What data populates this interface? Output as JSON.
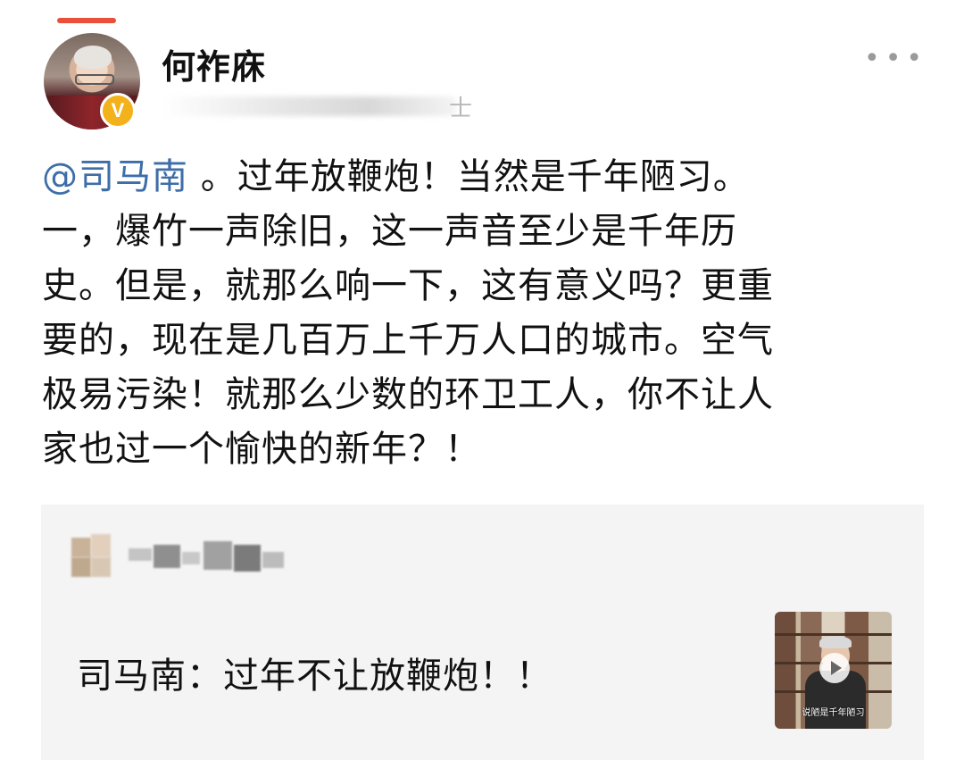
{
  "post": {
    "author": {
      "name": "何祚庥",
      "verified_badge": "V",
      "meta_tail": "士"
    },
    "more_icon": "more-dots-icon",
    "mention": "@司马南",
    "body_lines": [
      " 。过年放鞭炮！当然是千年陋习。",
      "一，爆竹一声除旧，这一声音至少是千年历",
      "史。但是，就那么响一下，这有意义吗？更重",
      "要的，现在是几百万上千万人口的城市。空气",
      "极易污染！就那么少数的环卫工人，你不让人",
      "家也过一个愉快的新年？！"
    ]
  },
  "repost": {
    "text": "司马南：过年不让放鞭炮！！",
    "video": {
      "caption": "说陋是千年陋习",
      "play_icon": "play-icon"
    }
  },
  "colors": {
    "mention": "#3e6ea8",
    "accent": "#e8503a",
    "verified": "#f3b21b",
    "card_bg": "#f4f4f4"
  }
}
